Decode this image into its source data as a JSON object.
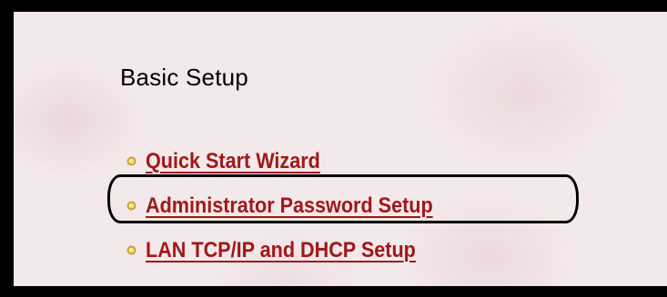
{
  "section": {
    "title": "Basic Setup"
  },
  "menu": {
    "items": [
      {
        "label": "Quick Start Wizard",
        "icon": "bullet-icon"
      },
      {
        "label": "Administrator Password Setup",
        "icon": "bullet-icon",
        "highlighted": true
      },
      {
        "label": "LAN TCP/IP and DHCP Setup",
        "icon": "bullet-icon"
      }
    ]
  },
  "colors": {
    "link": "#a01818",
    "bullet_outer": "#c8a040",
    "bullet_inner": "#ffe070",
    "background": "#f3e8ea",
    "frame": "#000000"
  }
}
